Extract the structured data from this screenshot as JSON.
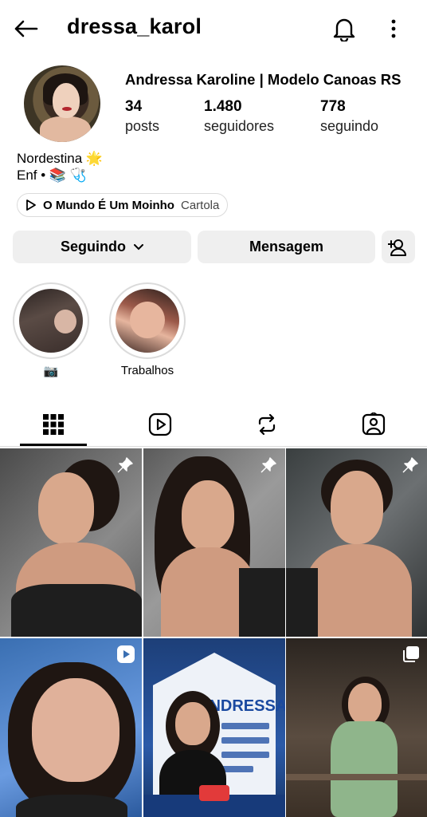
{
  "topbar": {
    "username": "dressa_karol",
    "back_icon": "arrow-left-icon",
    "bell_icon": "bell-icon",
    "more_icon": "more-vertical-icon"
  },
  "profile": {
    "full_name": "Andressa Karoline | Modelo Canoas RS",
    "stats": {
      "posts_value": "34",
      "posts_label": "posts",
      "followers_value": "1.480",
      "followers_label": "seguidores",
      "following_value": "778",
      "following_label": "seguindo"
    },
    "bio_line1": "Nordestina 🌟",
    "bio_line2": "Enf • 📚 🩺",
    "music": {
      "song": "O Mundo É Um Moinho",
      "artist": "Cartola"
    }
  },
  "actions": {
    "following_label": "Seguindo",
    "message_label": "Mensagem"
  },
  "highlights": [
    {
      "label": "📷"
    },
    {
      "label": "Trabalhos"
    }
  ],
  "tabs": [
    "grid-icon",
    "reels-icon",
    "reposts-icon",
    "tagged-icon"
  ],
  "grid": {
    "post5_text": "ANDRESSA"
  }
}
